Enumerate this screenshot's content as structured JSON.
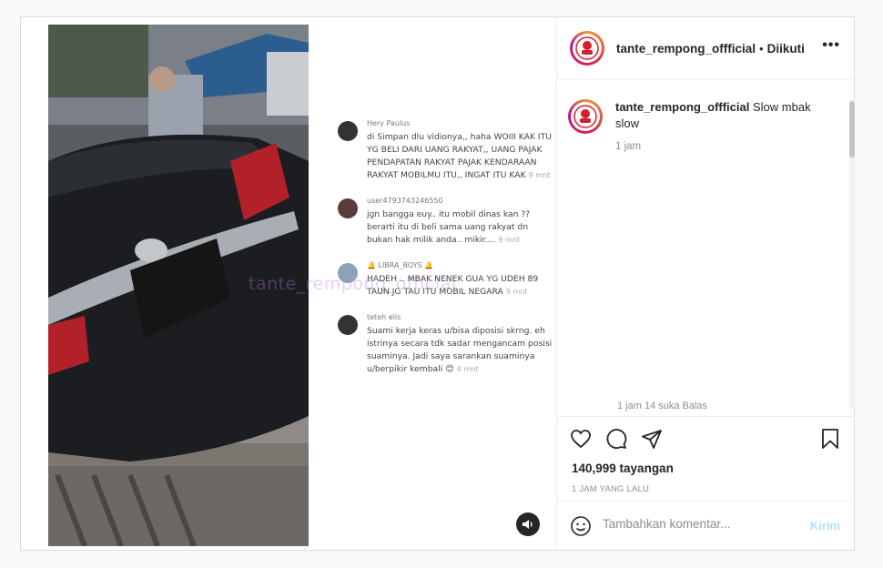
{
  "header": {
    "username": "tante_rempong_offficial",
    "separator": "•",
    "follow_status": "Diikuti",
    "more_label": "•••"
  },
  "caption": {
    "username": "tante_rempong_offficial",
    "text": "Slow mbak slow",
    "time": "1 jam"
  },
  "partial_comment_meta": "1 jam    14 suka    Balas",
  "actions": {
    "views": "140,999 tayangan",
    "posted": "1 JAM YANG LALU"
  },
  "add_comment": {
    "placeholder": "Tambahkan komentar...",
    "post_label": "Kirim"
  },
  "video": {
    "watermark": "tante_rempong_official",
    "overlay_comments": [
      {
        "user": "Hery Paulus",
        "text": "di Simpan dlu vidionya,, haha WOIII KAK ITU YG BELI DARI UANG RAKYAT,, UANG PAJAK PENDAPATAN RAKYAT PAJAK KENDARAAN RAKYAT MOBILMU ITU,, INGAT ITU KAK",
        "time": "9 mnt"
      },
      {
        "user": "user4793743246550",
        "text": "jgn bangga euy.. itu mobil dinas kan ?? berarti itu di beli sama uang rakyat dn bukan hak milik anda.. mikir....",
        "time": "9 mnt"
      },
      {
        "user": "🔔 LIBRA_BOYS 🔔",
        "text": "HADEH .. MBAK NENEK GUA YG UDEH 89 TAUN JG TAU ITU MOBIL NEGARA",
        "time": "9 mnt"
      },
      {
        "user": "teteh elis",
        "text": "Suami kerja keras u/bisa diposisi skrng. eh istrinya secara tdk sadar mengancam posisi suaminya. Jadi saya sarankan suaminya u/berpikir kembali 😊",
        "time": "4 mnt"
      }
    ]
  },
  "colors": {
    "post_button": "#b2dffc",
    "border": "#dbdbdb",
    "secondary_text": "#8e8e8e"
  }
}
